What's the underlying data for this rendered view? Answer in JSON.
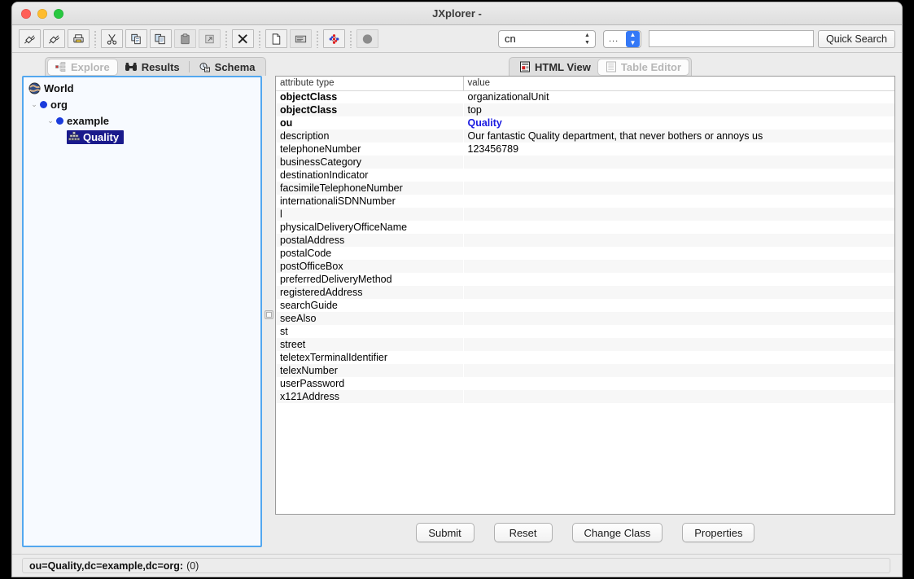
{
  "window": {
    "title": "JXplorer -",
    "traffic_lights": [
      "close",
      "minimize",
      "maximize"
    ]
  },
  "toolbar": {
    "buttons": [
      {
        "name": "connect-icon",
        "tooltip": "Connect"
      },
      {
        "name": "disconnect-icon",
        "tooltip": "Disconnect"
      },
      {
        "name": "print-icon",
        "tooltip": "Print"
      },
      {
        "name": "cut-icon",
        "tooltip": "Cut"
      },
      {
        "name": "copy-icon",
        "tooltip": "Copy"
      },
      {
        "name": "copy-dn-icon",
        "tooltip": "Copy DN"
      },
      {
        "name": "paste-icon",
        "tooltip": "Paste"
      },
      {
        "name": "paste-alias-icon",
        "tooltip": "Paste Alias"
      },
      {
        "name": "delete-icon",
        "tooltip": "Delete"
      },
      {
        "name": "new-entry-icon",
        "tooltip": "New Entry"
      },
      {
        "name": "table-editor-icon",
        "tooltip": "Table Editor"
      },
      {
        "name": "ldif-icon",
        "tooltip": "LDIF"
      },
      {
        "name": "stop-icon",
        "tooltip": "Stop"
      }
    ],
    "attribute_combo": {
      "value": "cn",
      "label": "attribute-select"
    },
    "filter_combo": {
      "value": "..."
    },
    "search_input": {
      "value": "",
      "placeholder": ""
    },
    "quick_search_label": "Quick Search"
  },
  "tabs": {
    "left": [
      {
        "label": "Explore",
        "icon": "explore-icon",
        "selected": true
      },
      {
        "label": "Results",
        "icon": "binoculars-icon",
        "selected": false
      },
      {
        "label": "Schema",
        "icon": "schema-icon",
        "selected": false
      }
    ],
    "right": [
      {
        "label": "HTML View",
        "icon": "html-view-icon",
        "selected": false
      },
      {
        "label": "Table Editor",
        "icon": "table-editor-icon",
        "selected": true
      }
    ]
  },
  "tree": [
    {
      "label": "World",
      "depth": 0,
      "icon": "world-icon",
      "twisty": "",
      "selected": false
    },
    {
      "label": "org",
      "depth": 1,
      "icon": "node-dot-icon",
      "twisty": "⌄",
      "selected": false
    },
    {
      "label": "example",
      "depth": 2,
      "icon": "node-dot-icon",
      "twisty": "⌄",
      "selected": false
    },
    {
      "label": "Quality",
      "depth": 3,
      "icon": "org-unit-icon",
      "twisty": "",
      "selected": true
    }
  ],
  "attribute_table": {
    "columns": [
      "attribute type",
      "value"
    ],
    "rows": [
      {
        "type": "objectClass",
        "value": "organizationalUnit",
        "bold": true,
        "value_blue": false
      },
      {
        "type": "objectClass",
        "value": "top",
        "bold": true,
        "value_blue": false
      },
      {
        "type": "ou",
        "value": "Quality",
        "bold": true,
        "value_blue": true
      },
      {
        "type": "description",
        "value": "Our fantastic Quality department, that never bothers or annoys us",
        "bold": false,
        "value_blue": false
      },
      {
        "type": "telephoneNumber",
        "value": "123456789",
        "bold": false,
        "value_blue": false
      },
      {
        "type": "businessCategory",
        "value": "",
        "bold": false,
        "value_blue": false
      },
      {
        "type": "destinationIndicator",
        "value": "",
        "bold": false,
        "value_blue": false
      },
      {
        "type": "facsimileTelephoneNumber",
        "value": "",
        "bold": false,
        "value_blue": false
      },
      {
        "type": "internationaliSDNNumber",
        "value": "",
        "bold": false,
        "value_blue": false
      },
      {
        "type": "l",
        "value": "",
        "bold": false,
        "value_blue": false
      },
      {
        "type": "physicalDeliveryOfficeName",
        "value": "",
        "bold": false,
        "value_blue": false
      },
      {
        "type": "postalAddress",
        "value": "",
        "bold": false,
        "value_blue": false
      },
      {
        "type": "postalCode",
        "value": "",
        "bold": false,
        "value_blue": false
      },
      {
        "type": "postOfficeBox",
        "value": "",
        "bold": false,
        "value_blue": false
      },
      {
        "type": "preferredDeliveryMethod",
        "value": "",
        "bold": false,
        "value_blue": false
      },
      {
        "type": "registeredAddress",
        "value": "",
        "bold": false,
        "value_blue": false
      },
      {
        "type": "searchGuide",
        "value": "",
        "bold": false,
        "value_blue": false
      },
      {
        "type": "seeAlso",
        "value": "",
        "bold": false,
        "value_blue": false
      },
      {
        "type": "st",
        "value": "",
        "bold": false,
        "value_blue": false
      },
      {
        "type": "street",
        "value": "",
        "bold": false,
        "value_blue": false
      },
      {
        "type": "teletexTerminalIdentifier",
        "value": "",
        "bold": false,
        "value_blue": false
      },
      {
        "type": "telexNumber",
        "value": "",
        "bold": false,
        "value_blue": false
      },
      {
        "type": "userPassword",
        "value": "",
        "bold": false,
        "value_blue": false
      },
      {
        "type": "x121Address",
        "value": "",
        "bold": false,
        "value_blue": false
      }
    ]
  },
  "buttons": [
    {
      "label": "Submit",
      "name": "submit-button"
    },
    {
      "label": "Reset",
      "name": "reset-button"
    },
    {
      "label": "Change Class",
      "name": "change-class-button"
    },
    {
      "label": "Properties",
      "name": "properties-button"
    }
  ],
  "status": {
    "dn": "ou=Quality,dc=example,dc=org:",
    "count": "(0)"
  },
  "colors": {
    "selection": "#1a1a8c",
    "value_highlight": "#1a1ae0",
    "panel_focus_border": "#53a7ef",
    "accent_blue": "#3478f6"
  }
}
